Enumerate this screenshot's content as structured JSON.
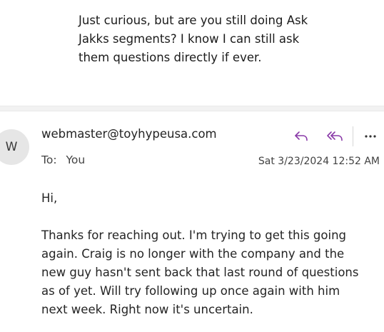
{
  "quoted_message": {
    "lines": [
      "Just curious, but are you still doing Ask",
      "Jakks segments? I know I can still ask",
      "them questions directly if ever."
    ]
  },
  "message": {
    "avatar_initial": "W",
    "sender": "webmaster@toyhypeusa.com",
    "to_label": "To:",
    "to_value": "You",
    "date": "Sat 3/23/2024 12:52 AM",
    "greeting": "Hi,",
    "body_lines": [
      "Thanks for reaching out. I'm trying to get this going",
      "again. Craig is no longer with the company and the",
      "new guy hasn't sent back that last round of questions",
      "as of yet. Will try following up once again with him",
      "next week. Right now it's uncertain."
    ]
  },
  "actions": {
    "reply_icon": "reply-arrow",
    "reply_all_icon": "reply-all-arrows",
    "more_icon": "horizontal-ellipsis",
    "accent_color": "#8a3aa8"
  }
}
